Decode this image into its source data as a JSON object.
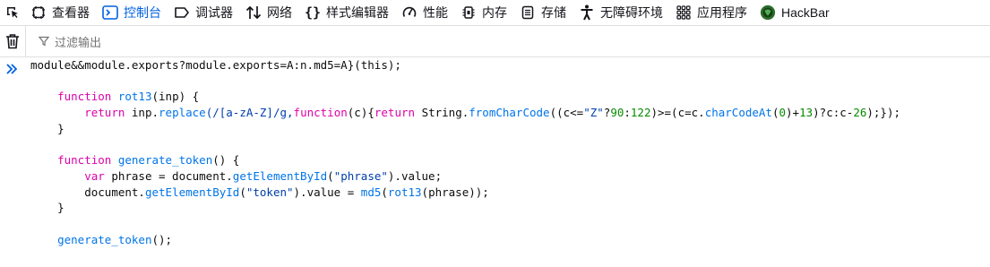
{
  "toolbar": {
    "tabs": [
      {
        "label": "查看器",
        "icon": "inspector-icon"
      },
      {
        "label": "控制台",
        "icon": "console-icon",
        "selected": true
      },
      {
        "label": "调试器",
        "icon": "debugger-icon"
      },
      {
        "label": "网络",
        "icon": "network-icon"
      },
      {
        "label": "样式编辑器",
        "icon": "style-editor-icon"
      },
      {
        "label": "性能",
        "icon": "performance-icon"
      },
      {
        "label": "内存",
        "icon": "memory-icon"
      },
      {
        "label": "存储",
        "icon": "storage-icon"
      },
      {
        "label": "无障碍环境",
        "icon": "accessibility-icon"
      },
      {
        "label": "应用程序",
        "icon": "application-icon"
      },
      {
        "label": "HackBar",
        "icon": "hackbar-icon"
      }
    ]
  },
  "filter": {
    "placeholder": "过滤输出"
  },
  "colors": {
    "selected_tab": "#0060df",
    "keyword": "#dd00a9",
    "function": "#0074e8",
    "string": "#003eaa",
    "number": "#058b00"
  },
  "code": {
    "line1": "module&&module.exports?module.exports=A:n.md5=A}(this);",
    "l2_kw": "function",
    "l2_name": "rot13",
    "l2_rest": "(inp) {",
    "l3_kw": "return",
    "l3_a": "inp.",
    "l3_replace": "replace",
    "l3_regex": "(/[a-zA-Z]/g,",
    "l3_fnkw": "function",
    "l3_b": "(c){",
    "l3_ret": "return",
    "l3_c": "String.",
    "l3_fcc": "fromCharCode",
    "l3_d": "((c<=",
    "l3_z": "\"Z\"",
    "l3_e": "?",
    "l3_n90": "90",
    "l3_f": ":",
    "l3_n122": "122",
    "l3_g": ")>=(c=c.",
    "l3_cca": "charCodeAt",
    "l3_h": "(",
    "l3_n0": "0",
    "l3_i": ")+",
    "l3_n13": "13",
    "l3_j": ")?c:c-",
    "l3_n26": "26",
    "l3_k": ");});",
    "close1": "}",
    "l5_kw": "function",
    "l5_name": "generate_token",
    "l5_rest": "() {",
    "l6_kw": "var",
    "l6_a": "phrase = document.",
    "l6_gebi": "getElementById",
    "l6_b": "(",
    "l6_str": "\"phrase\"",
    "l6_c": ").value;",
    "l7_a": "document.",
    "l7_gebi": "getElementById",
    "l7_b": "(",
    "l7_str": "\"token\"",
    "l7_c": ").value = ",
    "l7_md5": "md5",
    "l7_d": "(",
    "l7_rot": "rot13",
    "l7_e": "(phrase));",
    "close2": "}",
    "l9_name": "generate_token",
    "l9_rest": "();"
  }
}
